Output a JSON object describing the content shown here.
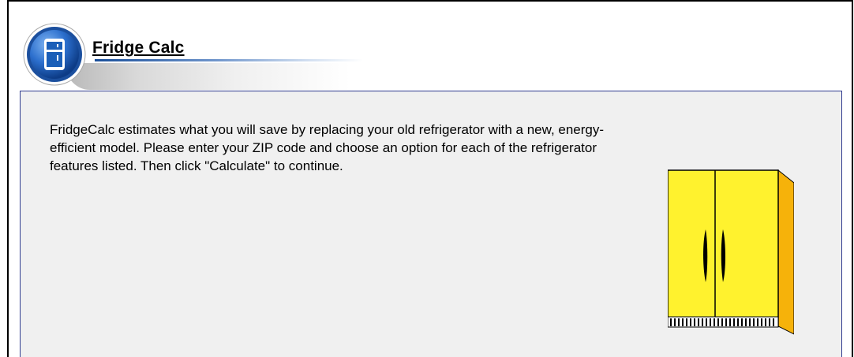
{
  "app": {
    "title": "Fridge Calc"
  },
  "intro": {
    "text": "FridgeCalc estimates what you will save by replacing your old refrigerator with a new, energy-efficient model. Please enter your ZIP code and choose an option for each of the refrigerator features listed. Then click \"Calculate\" to continue."
  },
  "icons": {
    "logo": "fridge-logo-icon",
    "illustration": "refrigerator-illustration"
  },
  "colors": {
    "panel_border": "#2f3b8f",
    "panel_background": "#f0f0f0",
    "fridge_yellow": "#fff22e",
    "fridge_side": "#f6b20a",
    "logo_blue": "#1b5fb8"
  }
}
